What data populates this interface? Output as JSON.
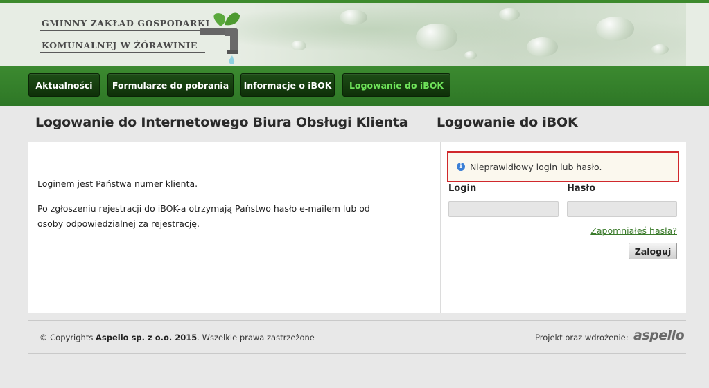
{
  "header": {
    "logo_line1": "GMINNY ZAKŁAD GOSPODARKI",
    "logo_line2": "KOMUNALNEJ W ŻÓRAWINIE"
  },
  "nav": {
    "items": [
      {
        "label": "Aktualności",
        "active": false
      },
      {
        "label": "Formularze do pobrania",
        "active": false
      },
      {
        "label": "Informacje o iBOK",
        "active": false
      },
      {
        "label": "Logowanie do iBOK",
        "active": true
      }
    ]
  },
  "main": {
    "heading": "Logowanie do Internetowego Biura Obsługi Klienta",
    "paragraph1": "Loginem jest Państwa numer klienta.",
    "paragraph2": "Po zgłoszeniu rejestracji do iBOK-a otrzymają Państwo hasło e-mailem lub od osoby odpowiedzialnej za rejestrację."
  },
  "login": {
    "heading": "Logowanie do iBOK",
    "alert": "Nieprawidłowy login lub hasło.",
    "login_label": "Login",
    "password_label": "Hasło",
    "login_value": "",
    "password_value": "",
    "forgot": "Zapomniałeś hasła?",
    "submit": "Zaloguj"
  },
  "footer": {
    "copyright_prefix": "© Copyrights ",
    "company": "Aspello sp. z o.o. 2015",
    "rights": ". Wszelkie prawa zastrzeżone",
    "project_label": "Projekt oraz wdrożenie:",
    "brand": "aspello"
  },
  "colors": {
    "nav_green": "#3c8a30",
    "nav_button": "#1d4d16",
    "active_text": "#6fe35a",
    "alert_border": "#d0282c",
    "link": "#3a7a2a"
  }
}
